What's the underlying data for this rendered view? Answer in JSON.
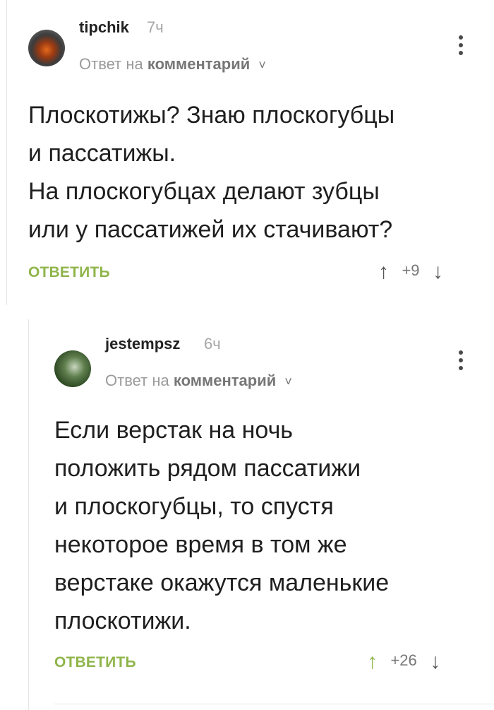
{
  "comments": [
    {
      "username": "tipchik",
      "time": "7ч",
      "reply_prefix": "Ответ на",
      "reply_target": "комментарий",
      "chevron": "˅",
      "paragraphs": [
        "Плоскотижы? Знаю плоскогубцы",
        "и пассатижы.",
        "На плоскогубцах делают зубцы",
        "или у пассатижей их стачивают?"
      ],
      "reply_label": "ОТВЕТИТЬ",
      "up_arrow": "↑",
      "score": "+9",
      "down_arrow": "↓",
      "upvoted": false
    },
    {
      "username": "jestempsz",
      "time": "6ч",
      "reply_prefix": "Ответ на",
      "reply_target": "комментарий",
      "chevron": "˅",
      "paragraphs": [
        "Если верстак на ночь",
        "положить рядом пассатижи",
        "и плоскогубцы, то спустя",
        "некоторое время в том же",
        "верстаке окажутся маленькие",
        "плоскотижи."
      ],
      "reply_label": "ОТВЕТИТЬ",
      "up_arrow": "↑",
      "score": "+26",
      "down_arrow": "↓",
      "upvoted": true
    }
  ],
  "colors": {
    "accent_green": "#8fb54a",
    "text": "#1f1f1f",
    "muted": "#9a9a9a"
  },
  "icons": {
    "more": "more-vertical-icon",
    "upvote": "arrow-up-icon",
    "downvote": "arrow-down-icon",
    "expand": "chevron-down-icon"
  }
}
